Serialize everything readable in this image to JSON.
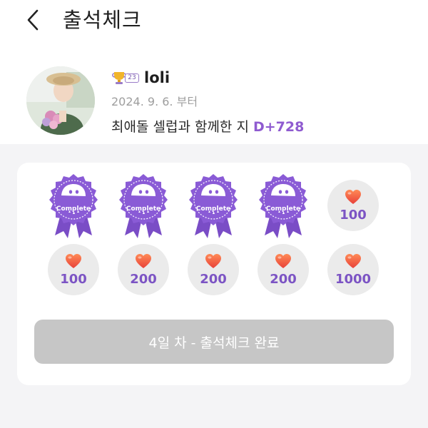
{
  "header": {
    "title": "출석체크",
    "back_icon": "chevron-left-icon"
  },
  "profile": {
    "badge_level": "23",
    "name": "loli",
    "since": "2024. 9. 6. 부터",
    "dday_label": "최애돌 셀럽과 함께한 지",
    "dday_value": "D+728"
  },
  "attendance": {
    "completed_label": "Complete",
    "rewards": [
      {
        "day": 1,
        "status": "complete",
        "amount": ""
      },
      {
        "day": 2,
        "status": "complete",
        "amount": ""
      },
      {
        "day": 3,
        "status": "complete",
        "amount": ""
      },
      {
        "day": 4,
        "status": "complete",
        "amount": ""
      },
      {
        "day": 5,
        "status": "pending",
        "amount": "100"
      },
      {
        "day": 6,
        "status": "pending",
        "amount": "100"
      },
      {
        "day": 7,
        "status": "pending",
        "amount": "200"
      },
      {
        "day": 8,
        "status": "pending",
        "amount": "200"
      },
      {
        "day": 9,
        "status": "pending",
        "amount": "200"
      },
      {
        "day": 10,
        "status": "pending",
        "amount": "1000"
      }
    ],
    "button_label": "4일 차 - 출석체크 완료"
  },
  "colors": {
    "accent": "#8f5bd0",
    "badge_purple": "#8a5bd6",
    "heart": "#f0573f",
    "button_disabled": "#c6c6c6"
  }
}
